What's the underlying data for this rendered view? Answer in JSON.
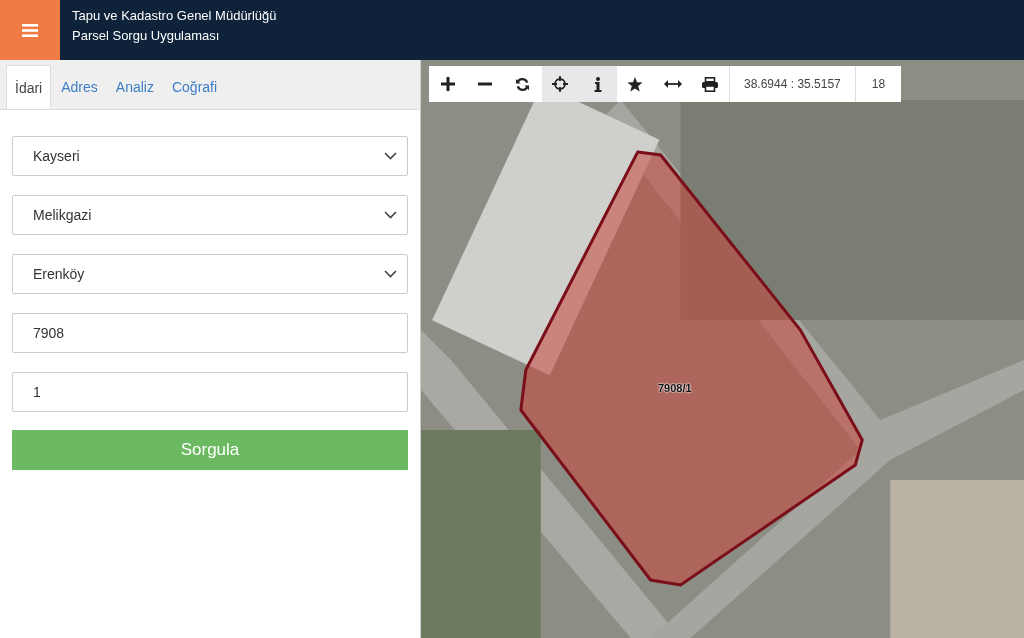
{
  "header": {
    "title": "Tapu ve Kadastro Genel Müdürlüğü",
    "subtitle": "Parsel Sorgu Uygulaması"
  },
  "tabs": [
    {
      "label": "İdari",
      "selected": true
    },
    {
      "label": "Adres",
      "selected": false
    },
    {
      "label": "Analiz",
      "selected": false
    },
    {
      "label": "Coğrafi",
      "selected": false
    }
  ],
  "form": {
    "fields": [
      {
        "kind": "select",
        "value": "Kayseri"
      },
      {
        "kind": "select",
        "value": "Melikgazi"
      },
      {
        "kind": "select",
        "value": "Erenköy"
      },
      {
        "kind": "input",
        "value": "7908"
      },
      {
        "kind": "input",
        "value": "1"
      }
    ],
    "submit": "Sorgula"
  },
  "map": {
    "toolbar": [
      {
        "kind": "zoom-in",
        "selected": false
      },
      {
        "kind": "zoom-out",
        "selected": false
      },
      {
        "kind": "refresh",
        "selected": false
      },
      {
        "kind": "locate",
        "selected": true
      },
      {
        "kind": "info",
        "selected": true
      },
      {
        "kind": "star",
        "selected": false
      },
      {
        "kind": "measure",
        "selected": false
      },
      {
        "kind": "print",
        "selected": false
      }
    ],
    "coordinates": "38.6944 : 35.5157",
    "zoom": "18",
    "parcel_label": "7908/1"
  }
}
